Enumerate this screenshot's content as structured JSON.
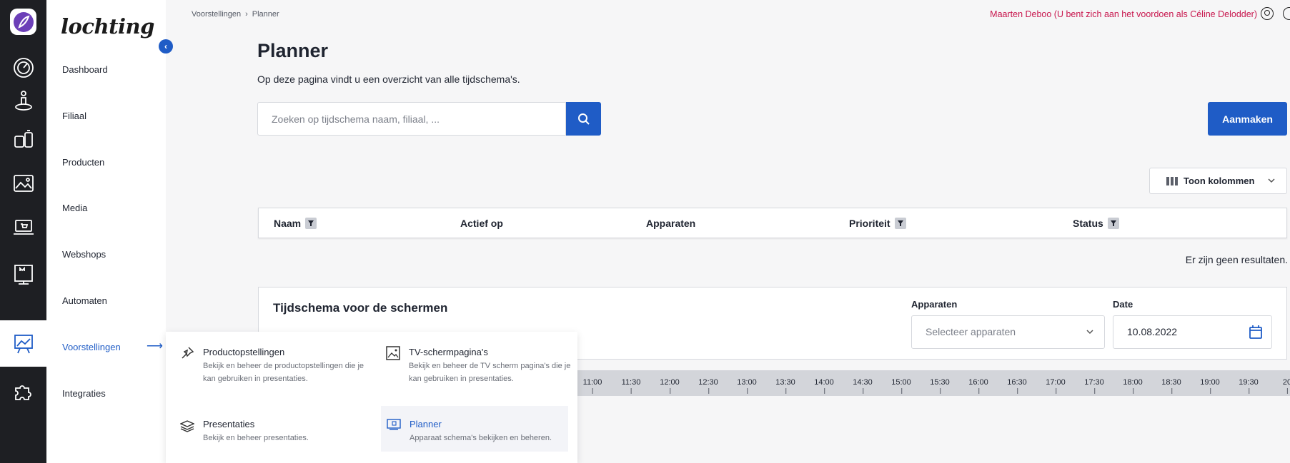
{
  "brand": {
    "name": "lochting"
  },
  "nav": {
    "items": [
      {
        "label": "Dashboard",
        "icon": "gauge-icon"
      },
      {
        "label": "Filiaal",
        "icon": "person-pin-icon"
      },
      {
        "label": "Producten",
        "icon": "products-icon"
      },
      {
        "label": "Media",
        "icon": "image-icon"
      },
      {
        "label": "Webshops",
        "icon": "laptop-cart-icon"
      },
      {
        "label": "Automaten",
        "icon": "vending-machine-icon"
      },
      {
        "label": "Voorstellingen",
        "icon": "presentation-icon",
        "active": true
      },
      {
        "label": "Integraties",
        "icon": "puzzle-icon"
      }
    ]
  },
  "header": {
    "breadcrumb": [
      "Voorstellingen",
      "Planner"
    ],
    "breadcrumb_separator": "›",
    "user_text": "Maarten Deboo (U bent zich aan het voordoen als Céline Delodder)"
  },
  "page": {
    "title": "Planner",
    "description": "Op deze pagina vindt u een overzicht van alle tijdschema's.",
    "search_placeholder": "Zoeken op tijdschema naam, filiaal, ...",
    "create_label": "Aanmaken",
    "columns_label": "Toon kolommen"
  },
  "table": {
    "columns": [
      "Naam",
      "Actief op",
      "Apparaten",
      "Prioriteit",
      "Status"
    ],
    "empty_text": "Er zijn geen resultaten."
  },
  "schedule": {
    "title": "Tijdschema voor de schermen",
    "devices_label": "Apparaten",
    "devices_placeholder": "Selecteer apparaten",
    "date_label": "Date",
    "date_value": "10.08.2022",
    "times": [
      "11:00",
      "11:30",
      "12:00",
      "12:30",
      "13:00",
      "13:30",
      "14:00",
      "14:30",
      "15:00",
      "15:30",
      "16:00",
      "16:30",
      "17:00",
      "17:30",
      "18:00",
      "18:30",
      "19:00",
      "19:30",
      "20"
    ]
  },
  "flyout": {
    "items": [
      {
        "title": "Productopstellingen",
        "desc": "Bekijk en beheer de productopstellingen die je kan gebruiken in presentaties.",
        "icon": "pin-icon"
      },
      {
        "title": "TV-schermpagina's",
        "desc": "Bekijk en beheer de TV scherm pagina's die je kan gebruiken in presentaties.",
        "icon": "tv-image-icon"
      },
      {
        "title": "Presentaties",
        "desc": "Bekijk en beheer presentaties.",
        "icon": "layers-icon"
      },
      {
        "title": "Planner",
        "desc": "Apparaat schema's bekijken en beheren.",
        "icon": "calendar-screen-icon",
        "active": true
      }
    ]
  },
  "colors": {
    "accent": "#1f5cc6",
    "rail": "#1e1f23",
    "user_text": "#c8174e"
  }
}
